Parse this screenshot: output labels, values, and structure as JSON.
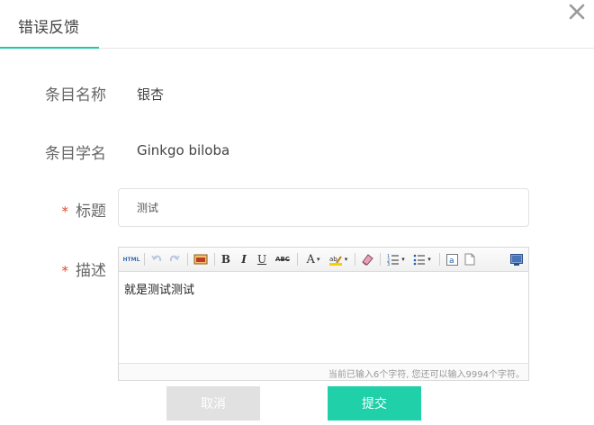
{
  "dialog": {
    "title": "错误反馈",
    "accent_color": "#1fc8a6",
    "close_icon": "close-icon"
  },
  "form": {
    "entry_name": {
      "label": "条目名称",
      "value": "银杏"
    },
    "entry_sci_name": {
      "label": "条目学名",
      "value": "Ginkgo biloba"
    },
    "title": {
      "required_mark": "*",
      "label": "标题",
      "value": "测试"
    },
    "description": {
      "required_mark": "*",
      "label": "描述",
      "content": "就是测试测试",
      "char_counter": "当前已输入6个字符, 您还可以输入9994个字符。"
    }
  },
  "toolbar": {
    "source": "HTML",
    "bold": "B",
    "italic": "I",
    "underline": "U",
    "strike": "ABC",
    "font_color": "A",
    "dropdown_glyph": "▾",
    "icons": [
      "html-source-icon",
      "undo-icon",
      "redo-icon",
      "image-icon",
      "bold-icon",
      "italic-icon",
      "underline-icon",
      "strikethrough-icon",
      "font-color-icon",
      "highlight-icon",
      "eraser-icon",
      "ordered-list-icon",
      "unordered-list-icon",
      "paste-text-icon",
      "blank-page-icon",
      "preview-icon"
    ]
  },
  "buttons": {
    "cancel": "取消",
    "submit": "提交",
    "submit_color": "#1fd0a8",
    "cancel_color": "#e1e1e1"
  }
}
